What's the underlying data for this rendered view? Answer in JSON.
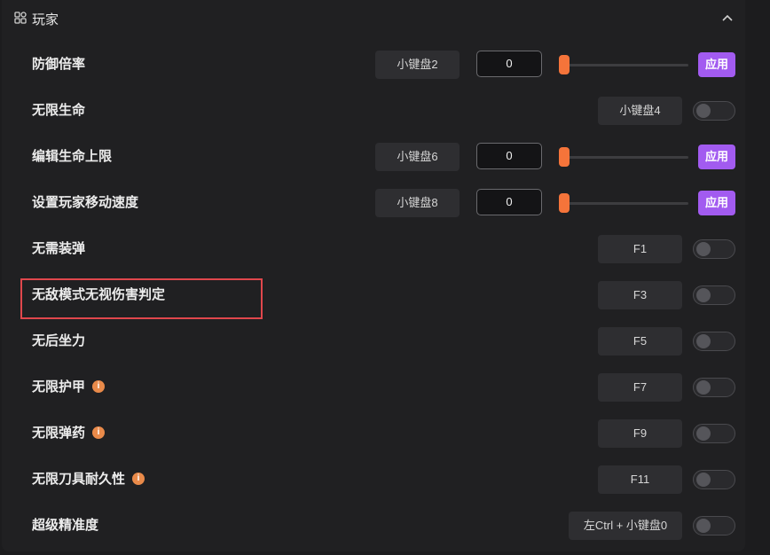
{
  "section": {
    "title": "玩家"
  },
  "rows": [
    {
      "label": "防御倍率",
      "hotkey": "小键盘2",
      "value": "0",
      "apply": "应用",
      "slider_fraction": 0
    },
    {
      "label": "无限生命",
      "hotkey": "小键盘4"
    },
    {
      "label": "编辑生命上限",
      "hotkey": "小键盘6",
      "value": "0",
      "apply": "应用",
      "slider_fraction": 0
    },
    {
      "label": "设置玩家移动速度",
      "hotkey": "小键盘8",
      "value": "0",
      "apply": "应用",
      "slider_fraction": 0
    },
    {
      "label": "无需装弹",
      "hotkey": "F1"
    },
    {
      "label": "无敌模式无视伤害判定",
      "hotkey": "F3"
    },
    {
      "label": "无后坐力",
      "hotkey": "F5"
    },
    {
      "label": "无限护甲",
      "hotkey": "F7",
      "info": "i"
    },
    {
      "label": "无限弹药",
      "hotkey": "F9",
      "info": "i"
    },
    {
      "label": "无限刀具耐久性",
      "hotkey": "F11",
      "info": "i"
    },
    {
      "label": "超级精准度",
      "hotkey": "左Ctrl + 小键盘0"
    }
  ],
  "colors": {
    "accent_apply": "#a25bf0",
    "slider": "#f5743a",
    "info_badge": "#e98a4a",
    "highlight_box": "#e0474c"
  },
  "icons": {
    "section": "grid-icon",
    "collapse": "chevron-up-icon",
    "info": "info-icon"
  }
}
